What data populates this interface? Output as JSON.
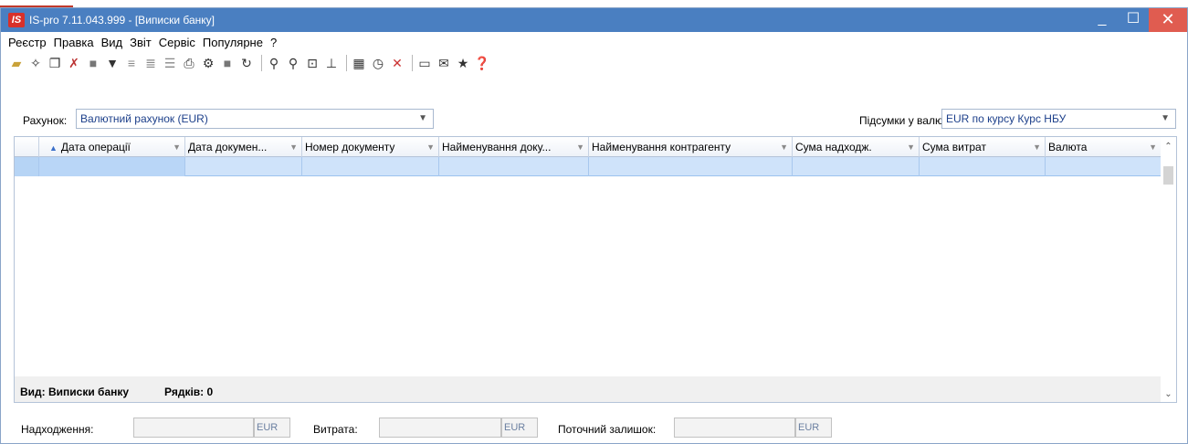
{
  "window": {
    "title": "IS-pro 7.11.043.999 - [Виписки банку]",
    "logo_text": "IS"
  },
  "controls": {
    "minimize": "_",
    "maximize": "☐",
    "close": "✕"
  },
  "menu": [
    "Реєстр",
    "Правка",
    "Вид",
    "Звіт",
    "Сервіс",
    "Популярне",
    "?"
  ],
  "toolbar": {
    "icons": [
      "open-folder-icon",
      "new-document-icon",
      "copy-document-icon",
      "delete-document-icon",
      "block-icon",
      "filter-icon",
      "split-icon",
      "merge-icon",
      "distribute-icon",
      "print-icon",
      "attach-icon",
      "stamp-icon",
      "refresh-icon",
      "search-icon",
      "find-next-icon",
      "locate-icon",
      "tree-icon",
      "table-icon",
      "schedule-icon",
      "clear-filter-icon",
      "window-icon",
      "mail-icon",
      "favorite-icon",
      "help-icon"
    ]
  },
  "filters": {
    "account_label": "Рахунок:",
    "account_value": "Валютний рахунок (EUR)",
    "totals_label": "Підсумки у валюті:",
    "totals_value": "EUR по курсу Курс НБУ"
  },
  "grid": {
    "columns": [
      "Дата операції",
      "Дата докумен...",
      "Номер документу",
      "Найменування доку...",
      "Найменування контрагенту",
      "Сума надходж.",
      "Сума витрат",
      "Валюта"
    ],
    "footer_view": "Вид: Виписки банку",
    "footer_rows": "Рядків: 0"
  },
  "summary": {
    "income_label": "Надходження:",
    "expense_label": "Витрата:",
    "balance_label": "Поточний залишок:",
    "currency": "EUR"
  }
}
